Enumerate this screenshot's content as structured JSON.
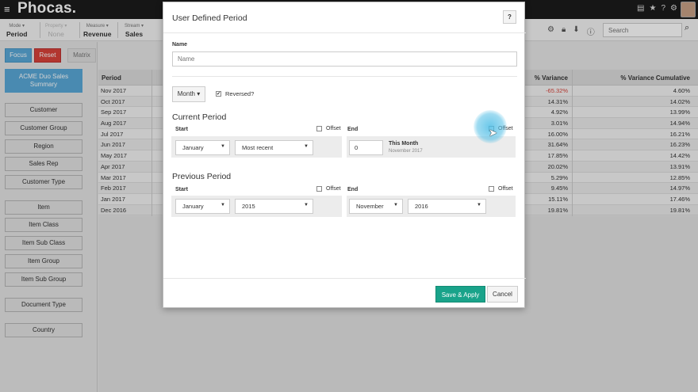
{
  "app": {
    "logo": "Phocas."
  },
  "toolbar": {
    "groups": [
      {
        "sub": "Mode ▾",
        "main": "Period"
      },
      {
        "sub": "Property ▾",
        "main": "None"
      },
      {
        "sub": "Measure ▾",
        "main": "Revenue"
      },
      {
        "sub": "Stream ▾",
        "main": "Sales"
      }
    ],
    "search_placeholder": "Search"
  },
  "left": {
    "focus": "Focus",
    "reset": "Reset",
    "matrix": "Matrix",
    "database": "ACME Duo Sales Summary",
    "dimensions": [
      "Customer",
      "Customer Group",
      "Region",
      "Sales Rep",
      "Customer Type",
      "Item",
      "Item Class",
      "Item Sub Class",
      "Item Group",
      "Item Sub Group",
      "Document Type",
      "Country"
    ]
  },
  "grid": {
    "headers": {
      "period": "Period",
      "variance": "% Variance",
      "cumulative": "% Variance Cumulative"
    },
    "rows": [
      {
        "period": "Nov 2017",
        "variance": "-65.32%",
        "cumulative": "4.60%"
      },
      {
        "period": "Oct 2017",
        "variance": "14.31%",
        "cumulative": "14.02%"
      },
      {
        "period": "Sep 2017",
        "variance": "4.92%",
        "cumulative": "13.99%"
      },
      {
        "period": "Aug 2017",
        "variance": "3.01%",
        "cumulative": "14.94%"
      },
      {
        "period": "Jul 2017",
        "variance": "16.00%",
        "cumulative": "16.21%"
      },
      {
        "period": "Jun 2017",
        "variance": "31.64%",
        "cumulative": "16.23%"
      },
      {
        "period": "May 2017",
        "variance": "17.85%",
        "cumulative": "14.42%"
      },
      {
        "period": "Apr 2017",
        "variance": "20.02%",
        "cumulative": "13.91%"
      },
      {
        "period": "Mar 2017",
        "variance": "5.29%",
        "cumulative": "12.85%"
      },
      {
        "period": "Feb 2017",
        "variance": "9.45%",
        "cumulative": "14.97%"
      },
      {
        "period": "Jan 2017",
        "variance": "15.11%",
        "cumulative": "17.46%"
      },
      {
        "period": "Dec 2016",
        "variance": "19.81%",
        "cumulative": "19.81%"
      }
    ],
    "negative_color": "#d9433a"
  },
  "modal": {
    "title": "User Defined Period",
    "help": "?",
    "name_label": "Name",
    "name_placeholder": "Name",
    "period_type": "Month ▾",
    "reversed_label": "Reversed?",
    "reversed_checked": true,
    "current": {
      "title": "Current Period",
      "start_label": "Start",
      "offset_label": "Offset",
      "end_label": "End",
      "start_month": "January",
      "start_year": "Most recent",
      "end_value": "0",
      "end_caption": "This Month",
      "end_sub": "November 2017"
    },
    "previous": {
      "title": "Previous Period",
      "start_label": "Start",
      "offset_label": "Offset",
      "end_label": "End",
      "start_month": "January",
      "start_year": "2015",
      "end_month": "November",
      "end_year": "2016"
    },
    "save_label": "Save & Apply",
    "cancel_label": "Cancel",
    "save_color": "#19a38a"
  }
}
